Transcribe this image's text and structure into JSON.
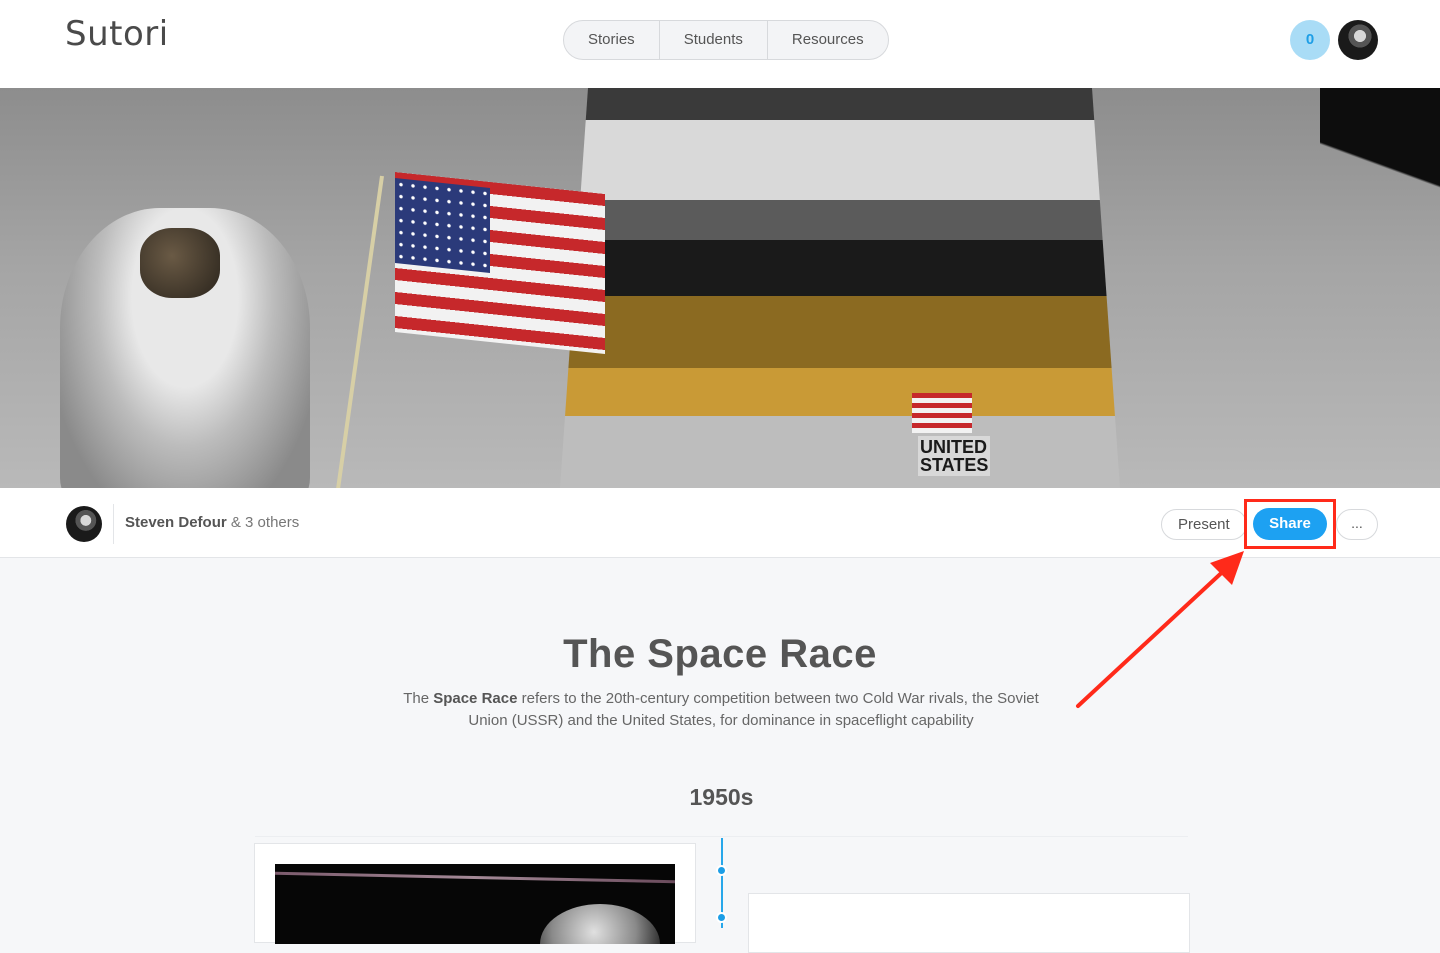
{
  "app": {
    "logo": "Sutori"
  },
  "nav": {
    "items": [
      {
        "label": "Stories"
      },
      {
        "label": "Students"
      },
      {
        "label": "Resources"
      }
    ]
  },
  "notifications": {
    "count": "0"
  },
  "hero": {
    "lander_text_1": "UNITED",
    "lander_text_2": "STATES"
  },
  "byline": {
    "author": "Steven Defour",
    "others": "& 3 others"
  },
  "actions": {
    "present": "Present",
    "share": "Share",
    "more": "..."
  },
  "story": {
    "title": "The Space Race",
    "desc_prefix": "The ",
    "desc_bold": "Space Race",
    "desc_rest": " refers to the 20th-century competition between two Cold War rivals, the Soviet Union (USSR) and the United States, for dominance in spaceflight capability",
    "era": "1950s"
  },
  "colors": {
    "accent": "#1da1f2",
    "highlight": "#ff2a1a",
    "notif_bg": "#a9dcf6"
  }
}
